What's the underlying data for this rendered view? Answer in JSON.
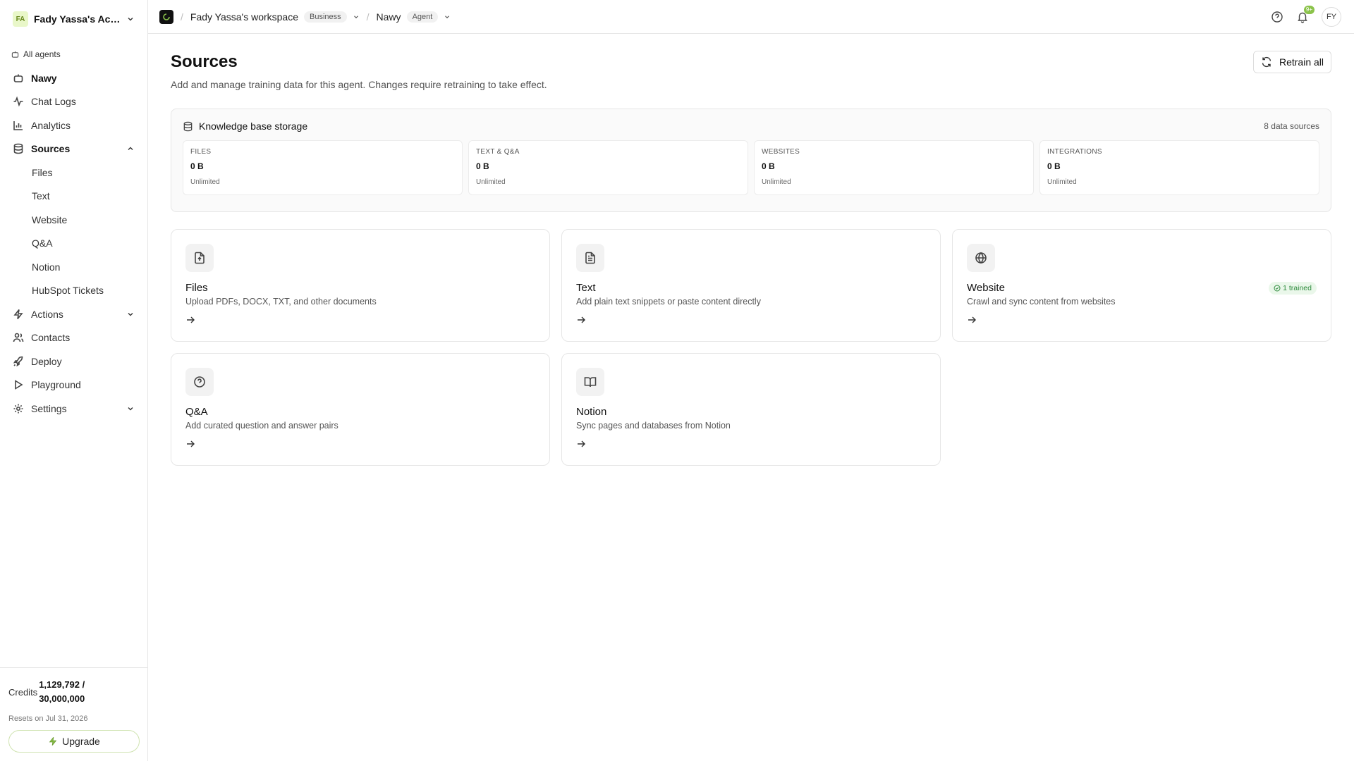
{
  "sidebar": {
    "account_initials": "FA",
    "account_name": "Fady Yassa's Acc...",
    "all_agents": "All agents",
    "agent_name": "Nawy",
    "items": [
      {
        "label": "Chat Logs",
        "icon": "activity-icon"
      },
      {
        "label": "Analytics",
        "icon": "bar-chart-icon"
      },
      {
        "label": "Sources",
        "icon": "database-icon"
      }
    ],
    "sources_sub": [
      "Files",
      "Text",
      "Website",
      "Q&A",
      "Notion",
      "HubSpot Tickets"
    ],
    "items_after": [
      {
        "label": "Actions",
        "icon": "zap-icon"
      },
      {
        "label": "Contacts",
        "icon": "users-icon"
      },
      {
        "label": "Deploy",
        "icon": "rocket-icon"
      },
      {
        "label": "Playground",
        "icon": "play-icon"
      },
      {
        "label": "Settings",
        "icon": "gear-icon"
      }
    ],
    "credits_label": "Credits",
    "credits_used": "1,129,792 /",
    "credits_total": "30,000,000",
    "resets": "Resets on Jul 31, 2026",
    "upgrade": "Upgrade"
  },
  "topbar": {
    "workspace": "Fady Yassa's workspace",
    "workspace_tag": "Business",
    "agent": "Nawy",
    "agent_tag": "Agent",
    "notification_badge": "9+",
    "user_initials": "FY"
  },
  "main": {
    "title": "Sources",
    "subtitle": "Add and manage training data for this agent. Changes require retraining to take effect.",
    "retrain": "Retrain all",
    "storage": {
      "title": "Knowledge base storage",
      "count": "8 data sources",
      "stats": [
        {
          "label": "FILES",
          "value": "0 B",
          "limit": "Unlimited"
        },
        {
          "label": "TEXT & Q&A",
          "value": "0 B",
          "limit": "Unlimited"
        },
        {
          "label": "WEBSITES",
          "value": "0 B",
          "limit": "Unlimited"
        },
        {
          "label": "INTEGRATIONS",
          "value": "0 B",
          "limit": "Unlimited"
        }
      ]
    },
    "cards": [
      {
        "title": "Files",
        "desc": "Upload PDFs, DOCX, TXT, and other documents"
      },
      {
        "title": "Text",
        "desc": "Add plain text snippets or paste content directly"
      },
      {
        "title": "Website",
        "desc": "Crawl and sync content from websites",
        "badge": "1 trained"
      },
      {
        "title": "Q&A",
        "desc": "Add curated question and answer pairs"
      },
      {
        "title": "Notion",
        "desc": "Sync pages and databases from Notion"
      }
    ]
  },
  "colors": {
    "accent": "#8bc34a",
    "trained_bg": "#eaf7ea",
    "trained_fg": "#2e8b3d"
  }
}
